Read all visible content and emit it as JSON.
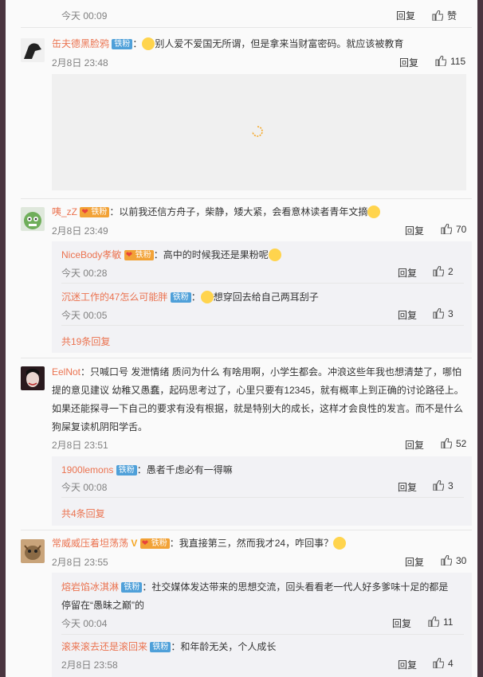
{
  "top_item": {
    "time": "今天 00:09",
    "reply": "回复",
    "like": "赞"
  },
  "comments": [
    {
      "user": "缶夫德黑脸鸦",
      "badge": "铁粉",
      "text": "别人爱不爱国无所谓，但是拿来当财富密码。就应该被教育",
      "time": "2月8日 23:48",
      "reply": "回复",
      "likes": "115"
    },
    {
      "user": "咦_zZ",
      "badge": "铁粉",
      "text": "以前我还信方舟子，柴静，矮大紧，会看意林读者青年文摘",
      "time": "2月8日 23:49",
      "reply": "回复",
      "likes": "70",
      "replies": [
        {
          "user": "NiceBody孝敏",
          "badge": "铁粉",
          "text": "高中的时候我还是果粉呢",
          "time": "今天 00:28",
          "reply": "回复",
          "likes": "2"
        },
        {
          "user": "沉迷工作的47怎么可能胖",
          "badge": "铁粉",
          "text": "想穿回去给自己两耳刮子",
          "time": "今天 00:05",
          "reply": "回复",
          "likes": "3"
        }
      ],
      "more": "共19条回复"
    },
    {
      "user": "EelNot",
      "text": "只喊口号 发泄情绪 质问为什么 有啥用啊，小学生都会。冲浪这些年我也想清楚了，哪怕提的意见建议 幼稚又愚蠢，起码思考过了，心里只要有12345，就有概率上到正确的讨论路径上。如果还能探寻一下自己的要求有没有根据，就是特别大的成长，这样才会良性的发言。而不是什么狗屎复读机阴阳学舌。",
      "text_lines": [
        "只喊口号 发泄情绪 质问为什么 有啥用啊，小学生都会。冲浪这些年我也想清楚了，哪怕",
        "提的意见建议 幼稚又愚蠢，起码思考过了，心里只要有12345，就有概率上到正确的讨论路径上。",
        "如果还能探寻一下自己的要求有没有根据，就是特别大的成长，这样才会良性的发言。而不是什么",
        "狗屎复读机阴阳学舌。"
      ],
      "time": "2月8日 23:51",
      "reply": "回复",
      "likes": "52",
      "replies": [
        {
          "user": "1900lemons",
          "badge": "铁粉",
          "text": "愚者千虑必有一得嘛",
          "time": "今天 00:08",
          "reply": "回复",
          "likes": "3"
        }
      ],
      "more": "共4条回复"
    },
    {
      "user": "常威威压着坦荡荡",
      "badge": "铁粉",
      "text": "我直接第三，然而我才24，咋回事？",
      "time": "2月8日 23:55",
      "reply": "回复",
      "likes": "30",
      "replies": [
        {
          "user": "熔岩馅冰淇淋",
          "badge": "铁粉",
          "text": "社交媒体发达带来的思想交流，回头看看老一代人好多爹味十足的都是停留在“愚昧之巅”的",
          "text_lines": [
            "社交媒体发达带来的思想交流，回头看看老一代人好多爹味十足的都是",
            "停留在“愚昧之巅”的"
          ],
          "time": "今天 00:04",
          "reply": "回复",
          "likes": "11"
        },
        {
          "user": "滚来滚去还是滚回来",
          "badge": "铁粉",
          "text": "和年龄无关，个人成长",
          "time": "2月8日 23:58",
          "reply": "回复",
          "likes": "4"
        }
      ]
    }
  ],
  "colors": {
    "accent": "#eb7350",
    "badge_blue": "#4fa0d9",
    "badge_gold": "#f2a236",
    "frame": "#4a3540"
  }
}
